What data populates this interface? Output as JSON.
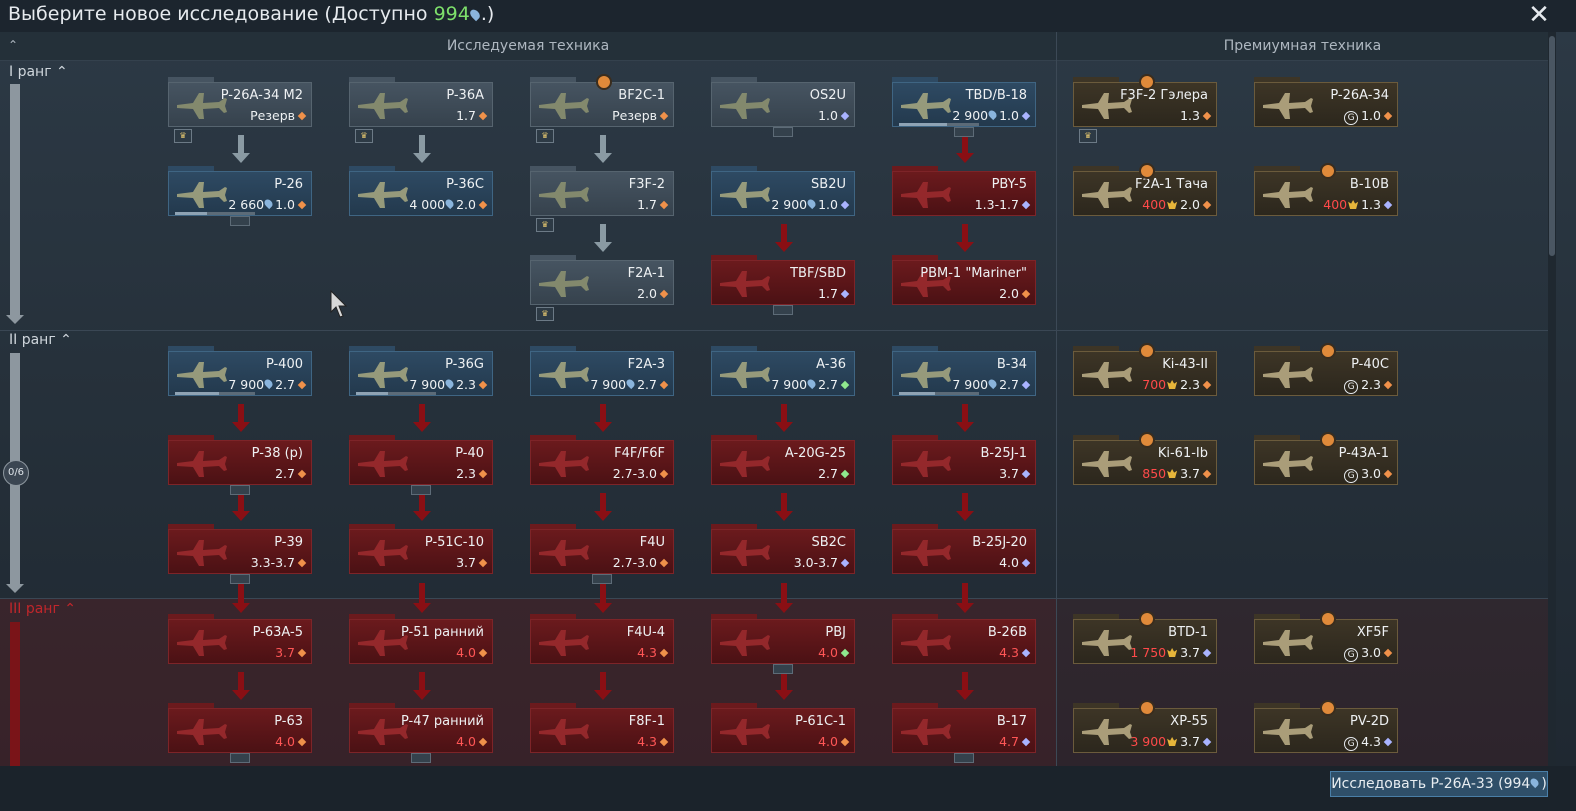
{
  "header": {
    "title_prefix": "Выберите новое исследование (Доступно ",
    "title_value": "994",
    "title_suffix": ".)",
    "accent_color": "#7ee06b"
  },
  "columns": {
    "researchable": "Исследуемая техника",
    "premium": "Премиумная техника"
  },
  "ranks": [
    {
      "label": "I ранг",
      "locked": false
    },
    {
      "label": "II ранг",
      "locked": false,
      "progress": "0/6"
    },
    {
      "label": "III ранг",
      "locked": true
    }
  ],
  "cards": [
    {
      "id": "p26a34m2",
      "name": "P-26A-34 M2",
      "status": "Резерв",
      "icon": "gem-orange"
    },
    {
      "id": "p36a",
      "name": "P-36A",
      "br": "1.7",
      "icon": "gem-orange"
    },
    {
      "id": "bf2c1",
      "name": "BF2C-1",
      "status": "Резерв",
      "icon": "gem-orange"
    },
    {
      "id": "os2u",
      "name": "OS2U",
      "br": "1.0",
      "icon": "gem-blue"
    },
    {
      "id": "tbdb18",
      "name": "TBD/B-18",
      "cost": "2 900",
      "br": "1.0",
      "icon": "gem-blue"
    },
    {
      "id": "p26",
      "name": "P-26",
      "cost": "2 660",
      "br": "1.0",
      "icon": "gem-orange"
    },
    {
      "id": "p36c",
      "name": "P-36C",
      "cost": "4 000",
      "br": "2.0",
      "icon": "gem-orange"
    },
    {
      "id": "f3f2",
      "name": "F3F-2",
      "br": "1.7",
      "icon": "gem-orange"
    },
    {
      "id": "sb2u",
      "name": "SB2U",
      "cost": "2 900",
      "br": "1.0",
      "icon": "gem-blue"
    },
    {
      "id": "pby5",
      "name": "PBY-5",
      "br": "1.3-1.7",
      "icon": "gem-blue"
    },
    {
      "id": "f2a1",
      "name": "F2A-1",
      "br": "2.0",
      "icon": "gem-orange"
    },
    {
      "id": "tbfsbd",
      "name": "TBF/SBD",
      "br": "1.7",
      "icon": "gem-blue"
    },
    {
      "id": "pbm1",
      "name": "PBM-1 \"Mariner\"",
      "br": "2.0",
      "icon": "gem-orange"
    },
    {
      "id": "p400",
      "name": "P-400",
      "cost": "7 900",
      "br": "2.7",
      "icon": "gem-orange"
    },
    {
      "id": "p36g",
      "name": "P-36G",
      "cost": "7 900",
      "br": "2.3",
      "icon": "gem-orange"
    },
    {
      "id": "f2a3",
      "name": "F2A-3",
      "cost": "7 900",
      "br": "2.7",
      "icon": "gem-orange"
    },
    {
      "id": "a36",
      "name": "A-36",
      "cost": "7 900",
      "br": "2.7",
      "icon": "gem-green"
    },
    {
      "id": "b34",
      "name": "B-34",
      "cost": "7 900",
      "br": "2.7",
      "icon": "gem-blue"
    },
    {
      "id": "p38p",
      "name": "P-38 (р)",
      "br": "2.7",
      "icon": "gem-orange"
    },
    {
      "id": "p40",
      "name": "P-40",
      "br": "2.3",
      "icon": "gem-orange"
    },
    {
      "id": "f4ff6f",
      "name": "F4F/F6F",
      "br": "2.7-3.0",
      "icon": "gem-orange"
    },
    {
      "id": "a20g25",
      "name": "A-20G-25",
      "br": "2.7",
      "icon": "gem-green"
    },
    {
      "id": "b25j1",
      "name": "B-25J-1",
      "br": "3.7",
      "icon": "gem-blue"
    },
    {
      "id": "p39",
      "name": "P-39",
      "br": "3.3-3.7",
      "icon": "gem-orange"
    },
    {
      "id": "p51c10",
      "name": "P-51C-10",
      "br": "3.7",
      "icon": "gem-orange"
    },
    {
      "id": "f4u",
      "name": "F4U",
      "br": "2.7-3.0",
      "icon": "gem-orange"
    },
    {
      "id": "sb2c",
      "name": "SB2C",
      "br": "3.0-3.7",
      "icon": "gem-blue"
    },
    {
      "id": "b25j20",
      "name": "B-25J-20",
      "br": "4.0",
      "icon": "gem-blue"
    },
    {
      "id": "p63a5",
      "name": "P-63A-5",
      "br": "3.7",
      "icon": "gem-orange"
    },
    {
      "id": "p51early",
      "name": "P-51 ранний",
      "br": "4.0",
      "icon": "gem-orange"
    },
    {
      "id": "f4u4",
      "name": "F4U-4",
      "br": "4.3",
      "icon": "gem-orange"
    },
    {
      "id": "pbj",
      "name": "PBJ",
      "br": "4.0",
      "icon": "gem-green"
    },
    {
      "id": "b26b",
      "name": "B-26B",
      "br": "4.3",
      "icon": "gem-blue"
    },
    {
      "id": "p63",
      "name": "P-63",
      "br": "4.0",
      "icon": "gem-orange"
    },
    {
      "id": "p47early",
      "name": "P-47 ранний",
      "br": "4.0",
      "icon": "gem-orange"
    },
    {
      "id": "f8f1",
      "name": "F8F-1",
      "br": "4.3",
      "icon": "gem-orange"
    },
    {
      "id": "p61c1",
      "name": "P-61C-1",
      "br": "4.0",
      "icon": "gem-orange"
    },
    {
      "id": "b17",
      "name": "B-17",
      "br": "4.7",
      "icon": "gem-blue"
    },
    {
      "id": "f3f2g",
      "name": "F3F-2 Гэлера",
      "br": "1.3",
      "icon": "gem-orange"
    },
    {
      "id": "p26a34",
      "name": "P-26A-34",
      "br": "1.0",
      "icon": "gem-orange"
    },
    {
      "id": "f2a1t",
      "name": "F2A-1 Тача",
      "cost": "400",
      "br": "2.0",
      "icon": "gem-orange"
    },
    {
      "id": "b10b",
      "name": "B-10B",
      "cost": "400",
      "br": "1.3",
      "icon": "gem-blue"
    },
    {
      "id": "ki43",
      "name": "Ki-43-II",
      "cost": "700",
      "br": "2.3",
      "icon": "gem-orange"
    },
    {
      "id": "p40c",
      "name": "P-40C",
      "br": "2.3",
      "icon": "gem-orange"
    },
    {
      "id": "ki61",
      "name": "Ki-61-Ib",
      "cost": "850",
      "br": "3.7",
      "icon": "gem-orange"
    },
    {
      "id": "p43a1",
      "name": "P-43A-1",
      "br": "3.0",
      "icon": "gem-orange"
    },
    {
      "id": "btd1",
      "name": "BTD-1",
      "cost": "1 750",
      "br": "3.7",
      "icon": "gem-blue"
    },
    {
      "id": "xf5f",
      "name": "XF5F",
      "br": "3.0",
      "icon": "gem-orange"
    },
    {
      "id": "xp55",
      "name": "XP-55",
      "cost": "3 900",
      "br": "3.7",
      "icon": "gem-blue"
    },
    {
      "id": "pv2d",
      "name": "PV-2D",
      "br": "4.3",
      "icon": "gem-blue"
    }
  ],
  "research_button": {
    "label": "Исследовать P-26A-33 (994",
    "suffix": ")"
  },
  "colors": {
    "researched": "#465461",
    "available": "#2e4a63",
    "locked": "#6b1a1d",
    "premium": "#3d3526",
    "br_locked": "#ff5656",
    "cost_locked": "#ff4a4a"
  }
}
